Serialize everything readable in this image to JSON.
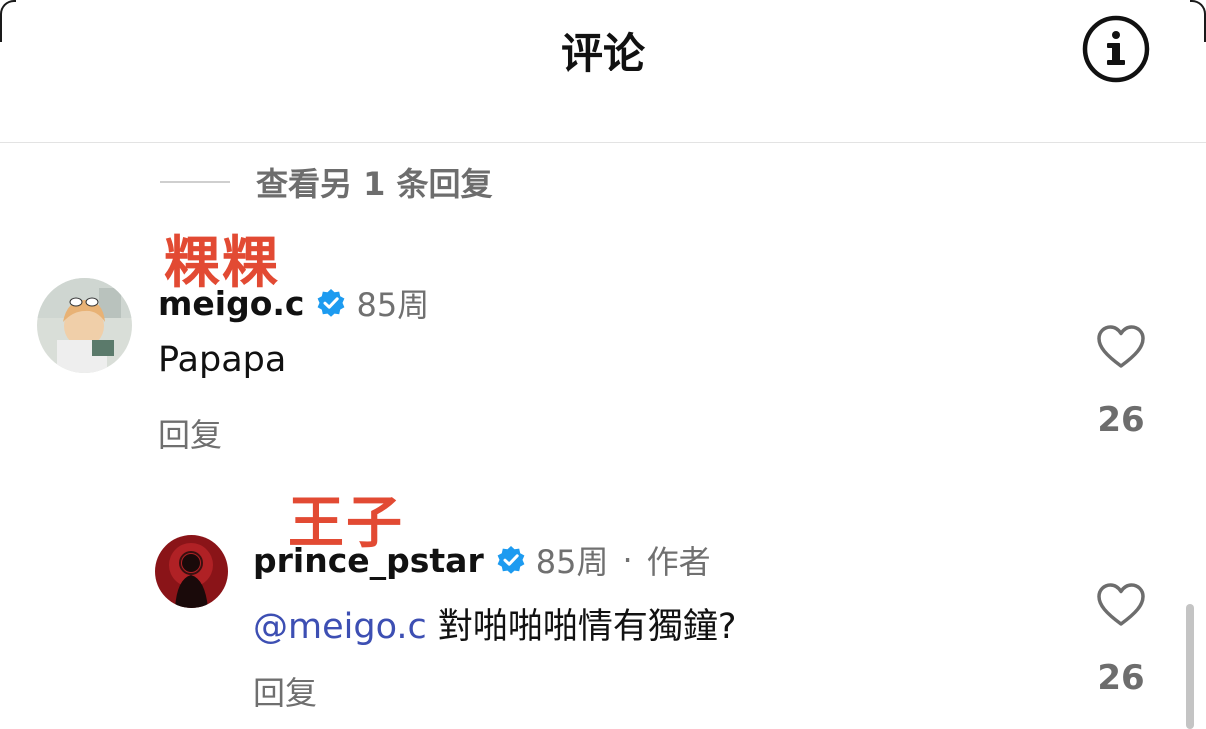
{
  "header": {
    "title": "评论",
    "info_icon": "info-circle-icon"
  },
  "thread": {
    "view_more_replies": "查看另 1 条回复"
  },
  "annotations": {
    "first": "粿粿",
    "second": "王子"
  },
  "comments": [
    {
      "username": "meigo.c",
      "verified": true,
      "time": "85周",
      "text": "Papapa",
      "reply_label": "回复",
      "likes": "26"
    },
    {
      "username": "prince_pstar",
      "verified": true,
      "time": "85周",
      "separator": "·",
      "role": "作者",
      "mention": "@meigo.c",
      "text": " 對啪啪啪情有獨鐘?",
      "reply_label": "回复",
      "likes": "26"
    }
  ],
  "colors": {
    "annotation_red": "#e24a33",
    "verified_blue": "#1d9bf0",
    "mention_blue": "#3d4fb3",
    "meta_gray": "#707070"
  }
}
